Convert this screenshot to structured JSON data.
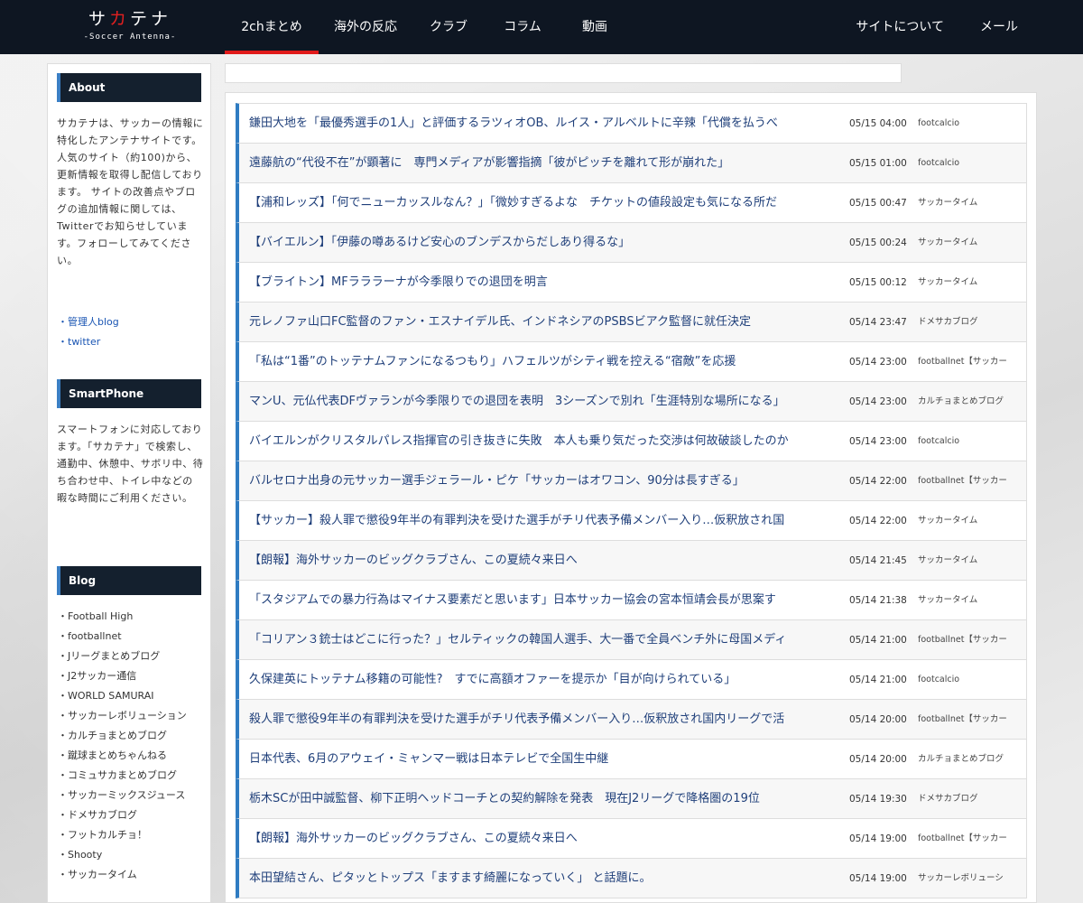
{
  "header": {
    "logo_main_1": "サ",
    "logo_main_red": "カ",
    "logo_main_2": "テナ",
    "logo_sub": "-Soccer Antenna-",
    "nav": [
      {
        "label": "2chまとめ"
      },
      {
        "label": "海外の反応"
      },
      {
        "label": "クラブ"
      },
      {
        "label": "コラム"
      },
      {
        "label": "動画"
      }
    ],
    "nav_right": [
      {
        "label": "サイトについて"
      },
      {
        "label": "メール"
      }
    ]
  },
  "sidebar": {
    "about_title": "About",
    "about_text": "サカテナは、サッカーの情報に特化したアンテナサイトです。 人気のサイト（約100)から、更新情報を取得し配信しております。 サイトの改善点やブログの追加情報に関しては、 Twitterでお知らせしています。フォローしてみてください。",
    "about_links": [
      "管理人blog",
      "twitter"
    ],
    "smartphone_title": "SmartPhone",
    "smartphone_text": "スマートフォンに対応しております。「サカテナ」で検索し、通勤中、休憩中、サボリ中、待ち合わせ中、トイレ中などの 暇な時間にご利用ください。",
    "blog_title": "Blog",
    "blogs": [
      "Football High",
      "footballnet",
      "Jリーグまとめブログ",
      "J2サッカー通信",
      "WORLD SAMURAI",
      "サッカーレボリューション",
      "カルチョまとめブログ",
      "蹴球まとめちゃんねる",
      "コミュサカまとめブログ",
      "サッカーミックスジュース",
      "ドメサカブログ",
      "フットカルチョ！",
      "Shooty",
      "サッカータイム"
    ]
  },
  "feed": [
    {
      "title": "鎌田大地を「最優秀選手の1人」と評価するラツィオOB、ルイス・アルベルトに辛辣「代償を払うべ",
      "date": "05/15 04:00",
      "source": "footcalcio"
    },
    {
      "title": "遠藤航の“代役不在”が顕著に　専門メディアが影響指摘「彼がピッチを離れて形が崩れた」",
      "date": "05/15 01:00",
      "source": "footcalcio"
    },
    {
      "title": "【浦和レッズ】「何でニューカッスルなん？」「微妙すぎるよな　チケットの値段設定も気になる所だ",
      "date": "05/15 00:47",
      "source": "サッカータイム"
    },
    {
      "title": "【バイエルン】「伊藤の噂あるけど安心のブンデスからだしあり得るな」",
      "date": "05/15 00:24",
      "source": "サッカータイム"
    },
    {
      "title": "【ブライトン】MFラララーナが今季限りでの退団を明言",
      "date": "05/15 00:12",
      "source": "サッカータイム"
    },
    {
      "title": "元レノファ山口FC監督のファン・エスナイデル氏、インドネシアのPSBSビアク監督に就任決定",
      "date": "05/14 23:47",
      "source": "ドメサカブログ"
    },
    {
      "title": "「私は“1番”のトッテナムファンになるつもり」ハフェルツがシティ戦を控える“宿敵”を応援",
      "date": "05/14 23:00",
      "source": "footballnet【サッカー"
    },
    {
      "title": "マンU、元仏代表DFヴァランが今季限りでの退団を表明　3シーズンで別れ「生涯特別な場所になる」",
      "date": "05/14 23:00",
      "source": "カルチョまとめブログ"
    },
    {
      "title": "バイエルンがクリスタルパレス指揮官の引き抜きに失敗　本人も乗り気だった交渉は何故破談したのか",
      "date": "05/14 23:00",
      "source": "footcalcio"
    },
    {
      "title": "バルセロナ出身の元サッカー選手ジェラール・ピケ「サッカーはオワコン、90分は長すぎる」",
      "date": "05/14 22:00",
      "source": "footballnet【サッカー"
    },
    {
      "title": "【サッカー】殺人罪で懲役9年半の有罪判決を受けた選手がチリ代表予備メンバー入り…仮釈放され国",
      "date": "05/14 22:00",
      "source": "サッカータイム"
    },
    {
      "title": "【朗報】海外サッカーのビッグクラブさん、この夏続々来日へ",
      "date": "05/14 21:45",
      "source": "サッカータイム"
    },
    {
      "title": "「スタジアムでの暴力行為はマイナス要素だと思います」日本サッカー協会の宮本恒靖会長が思案す",
      "date": "05/14 21:38",
      "source": "サッカータイム"
    },
    {
      "title": "「コリアン３銃士はどこに行った？」セルティックの韓国人選手、大一番で全員ベンチ外に母国メディ",
      "date": "05/14 21:00",
      "source": "footballnet【サッカー"
    },
    {
      "title": "久保建英にトッテナム移籍の可能性?　すでに高額オファーを提示か「目が向けられている」",
      "date": "05/14 21:00",
      "source": "footcalcio"
    },
    {
      "title": "殺人罪で懲役9年半の有罪判決を受けた選手がチリ代表予備メンバー入り…仮釈放され国内リーグで活",
      "date": "05/14 20:00",
      "source": "footballnet【サッカー"
    },
    {
      "title": "日本代表、6月のアウェイ・ミャンマー戦は日本テレビで全国生中継",
      "date": "05/14 20:00",
      "source": "カルチョまとめブログ"
    },
    {
      "title": "栃木SCが田中誠監督、柳下正明ヘッドコーチとの契約解除を発表　現在J2リーグで降格圏の19位",
      "date": "05/14 19:30",
      "source": "ドメサカブログ"
    },
    {
      "title": "【朗報】海外サッカーのビッグクラブさん、この夏続々来日へ",
      "date": "05/14 19:00",
      "source": "footballnet【サッカー"
    },
    {
      "title": "本田望結さん、ピタッとトップス「ますます綺麗になっていく」 と話題に。",
      "date": "05/14 19:00",
      "source": "サッカーレボリューシ"
    }
  ]
}
